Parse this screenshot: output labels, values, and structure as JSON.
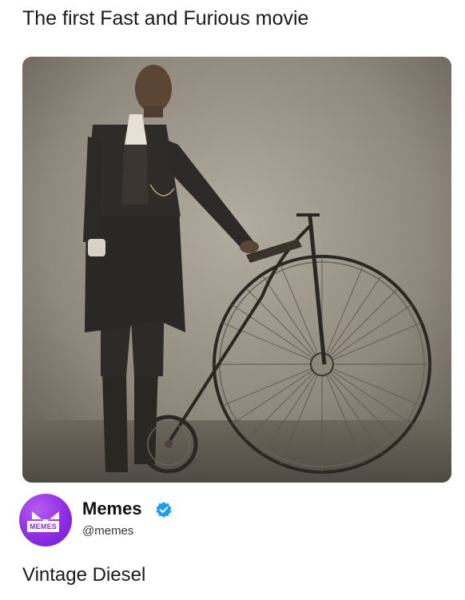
{
  "post": {
    "caption_top": "The first Fast and Furious movie",
    "caption_bottom": "Vintage Diesel"
  },
  "author": {
    "display_name": "Memes",
    "handle": "@memes",
    "avatar_label": "MEMES",
    "verified": true
  },
  "photo": {
    "description_icon": "vintage-photo-man-with-penny-farthing"
  },
  "colors": {
    "brand": "#8a2be2",
    "verified": "#1d9bf0",
    "sepia_bg": "#8a847a"
  }
}
